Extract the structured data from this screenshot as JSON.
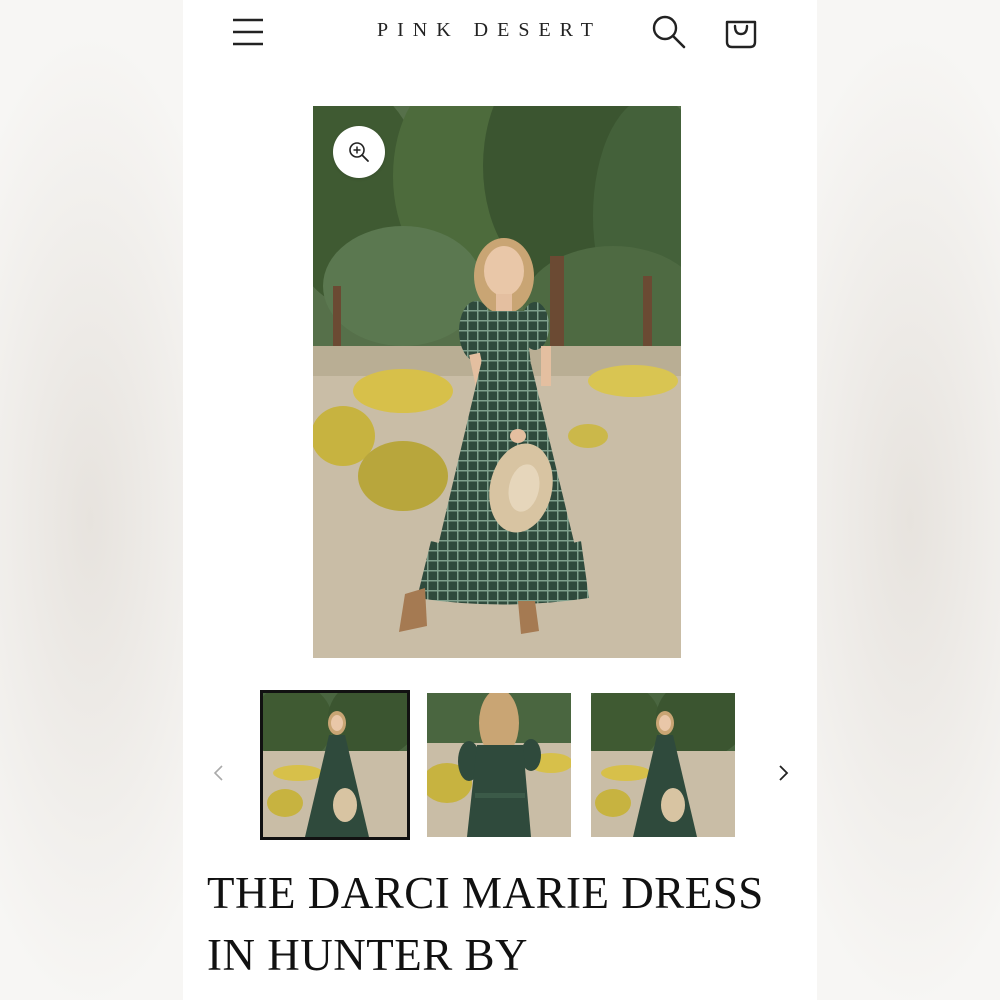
{
  "header": {
    "brand": "PINK DESERT",
    "menu_icon": "hamburger-menu-icon",
    "search_icon": "search-icon",
    "cart_icon": "shopping-bag-icon"
  },
  "gallery": {
    "zoom_icon": "zoom-in-icon",
    "thumbnails": [
      {
        "view": "front",
        "selected": true
      },
      {
        "view": "back",
        "selected": false
      },
      {
        "view": "front",
        "selected": false
      }
    ],
    "prev_icon": "chevron-left-icon",
    "next_icon": "chevron-right-icon"
  },
  "product": {
    "title": "THE DARCI MARIE DRESS IN HUNTER BY"
  },
  "colors": {
    "dress": "#2f4a3c",
    "dress_check": "#7fa08c",
    "foliage": "#3f5a32",
    "shrub": "#d7c04a",
    "ground": "#c9bda6",
    "hat": "#d8c4a2"
  }
}
